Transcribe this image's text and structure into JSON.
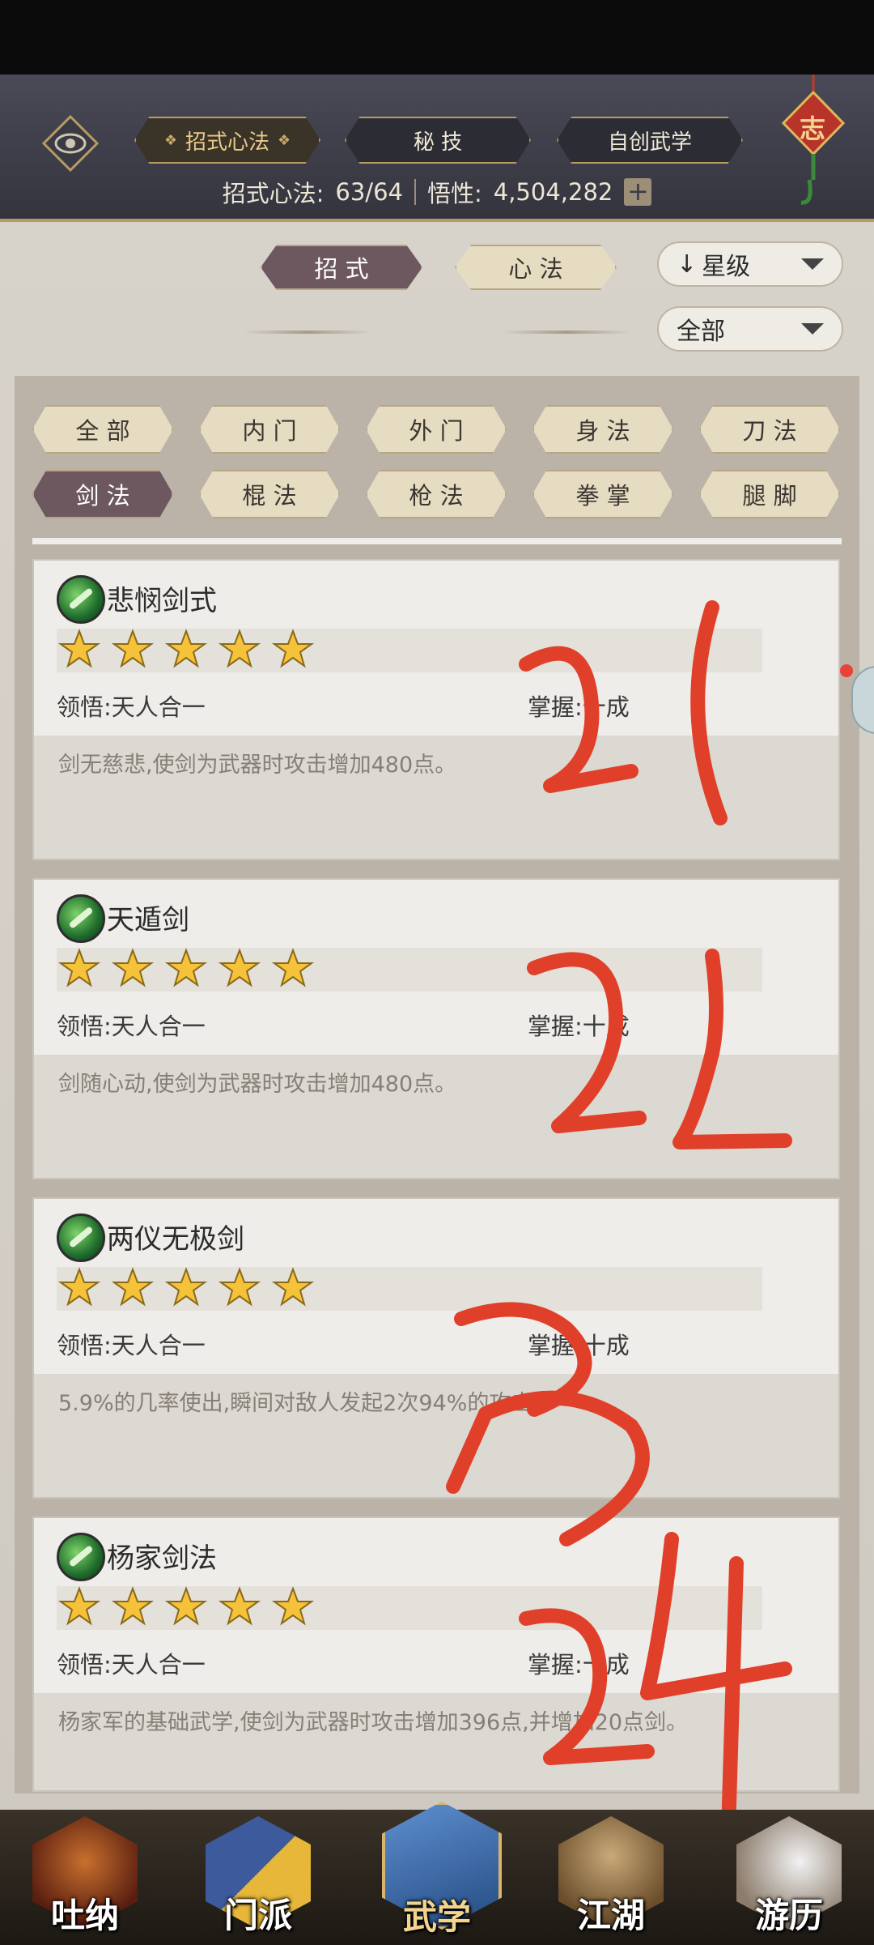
{
  "header": {
    "tabs": [
      {
        "label": "招式心法",
        "active": true
      },
      {
        "label": "秘 技",
        "active": false
      },
      {
        "label": "自创武学",
        "active": false
      }
    ],
    "stats": {
      "label1": "招式心法:",
      "value1": "63/64",
      "label2": "悟性:",
      "value2": "4,504,282",
      "plus": "+"
    },
    "knot_char": "志"
  },
  "subtabs": [
    {
      "label": "招 式",
      "active": true
    },
    {
      "label": "心 法",
      "active": false
    }
  ],
  "sort_dropdown": {
    "arrow": "↓",
    "label": "星级"
  },
  "filter_dropdown": {
    "label": "全部"
  },
  "categories": [
    {
      "label": "全 部",
      "active": false
    },
    {
      "label": "内 门",
      "active": false
    },
    {
      "label": "外 门",
      "active": false
    },
    {
      "label": "身 法",
      "active": false
    },
    {
      "label": "刀 法",
      "active": false
    },
    {
      "label": "剑 法",
      "active": true
    },
    {
      "label": "棍 法",
      "active": false
    },
    {
      "label": "枪 法",
      "active": false
    },
    {
      "label": "拳 掌",
      "active": false
    },
    {
      "label": "腿 脚",
      "active": false
    }
  ],
  "skills": [
    {
      "name": "悲悯剑式",
      "stars": 5,
      "comprehension": "领悟:天人合一",
      "mastery": "掌握:十成",
      "desc": "剑无慈悲,使剑为武器时攻击增加480点。"
    },
    {
      "name": "天遁剑",
      "stars": 5,
      "comprehension": "领悟:天人合一",
      "mastery": "掌握:十成",
      "desc": "剑随心动,使剑为武器时攻击增加480点。"
    },
    {
      "name": "两仪无极剑",
      "stars": 5,
      "comprehension": "领悟:天人合一",
      "mastery": "掌握:十成",
      "desc": "5.9%的几率使出,瞬间对敌人发起2次94%的攻击。"
    },
    {
      "name": "杨家剑法",
      "stars": 5,
      "comprehension": "领悟:天人合一",
      "mastery": "掌握:十成",
      "desc": "杨家军的基础武学,使剑为武器时攻击增加396点,并增加20点剑。"
    }
  ],
  "annotations": [
    "21",
    "22",
    "23",
    "24"
  ],
  "bottom_nav": [
    {
      "label": "吐纳",
      "active": false,
      "color": "#7a2d1c"
    },
    {
      "label": "门派",
      "active": false,
      "color": "#3d5a9c"
    },
    {
      "label": "武学",
      "active": true,
      "color": "#3b6aa8"
    },
    {
      "label": "江湖",
      "active": false,
      "color": "#8a6a3f"
    },
    {
      "label": "游历",
      "active": false,
      "color": "#5a4a3e"
    }
  ],
  "colors": {
    "accent_gold": "#b89b62",
    "active_pill": "#6e5860",
    "annotation_red": "#e0402a"
  }
}
